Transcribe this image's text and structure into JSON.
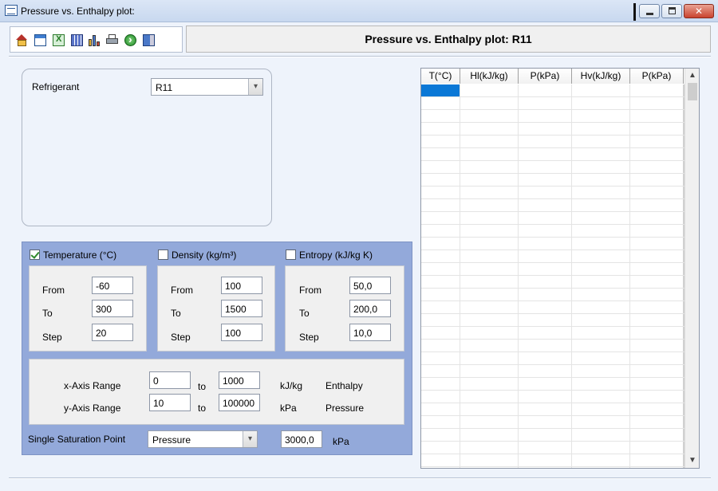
{
  "window": {
    "title": "Pressure vs. Enthalpy plot:",
    "minimize_glyph": "",
    "maximize_glyph": "",
    "close_glyph": "✕"
  },
  "toolbar": {
    "icons": [
      "home-icon",
      "window-icon",
      "excel-export-icon",
      "calculator-icon",
      "chart-icon",
      "print-icon",
      "go-icon",
      "exit-icon"
    ]
  },
  "header": {
    "title": "Pressure vs. Enthalpy plot: R11"
  },
  "refrigerant": {
    "label": "Refrigerant",
    "value": "R11"
  },
  "temperature": {
    "label": "Temperature (°C)",
    "checked": true,
    "from_label": "From",
    "from": "-60",
    "to_label": "To",
    "to": "300",
    "step_label": "Step",
    "step": "20"
  },
  "density": {
    "label": "Density (kg/m³)",
    "checked": false,
    "from_label": "From",
    "from": "100",
    "to_label": "To",
    "to": "1500",
    "step_label": "Step",
    "step": "100"
  },
  "entropy": {
    "label": "Entropy (kJ/kg K)",
    "checked": false,
    "from_label": "From",
    "from": "50,0",
    "to_label": "To",
    "to": "200,0",
    "step_label": "Step",
    "step": "10,0"
  },
  "axis": {
    "x_label": "x-Axis Range",
    "x_from": "0",
    "x_to_label": "to",
    "x_to": "1000",
    "x_unit": "kJ/kg",
    "x_quantity": "Enthalpy",
    "y_label": "y-Axis Range",
    "y_from": "10",
    "y_to_label": "to",
    "y_to": "100000",
    "y_unit": "kPa",
    "y_quantity": "Pressure"
  },
  "saturation": {
    "label": "Single Saturation Point",
    "mode": "Pressure",
    "value": "3000,0",
    "unit": "kPa"
  },
  "grid": {
    "columns": [
      "T(°C)",
      "Hl(kJ/kg)",
      "P(kPa)",
      "Hv(kJ/kg)",
      "P(kPa)"
    ],
    "selection_color": "#0a78d6"
  },
  "colors": {
    "panel_blue": "#93a9da",
    "selection": "#0a78d6"
  }
}
